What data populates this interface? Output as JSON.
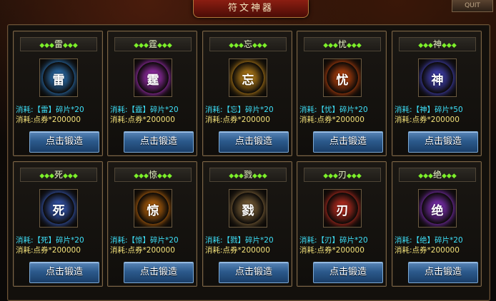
{
  "window": {
    "title": "符文神器",
    "quit_label": "QUIT"
  },
  "cards": [
    {
      "name": "雷",
      "cost_item": "消耗:【雷】碎片*20",
      "cost_coupon": "消耗:点券*200000",
      "button": "点击锻造",
      "color": "#3aa0ff"
    },
    {
      "name": "霆",
      "cost_item": "消耗:【霆】碎片*20",
      "cost_coupon": "消耗:点券*200000",
      "button": "点击锻造",
      "color": "#e040ff"
    },
    {
      "name": "忘",
      "cost_item": "消耗:【忘】碎片*20",
      "cost_coupon": "消耗:点券*200000",
      "button": "点击锻造",
      "color": "#ffb020"
    },
    {
      "name": "忧",
      "cost_item": "消耗:【忧】碎片*20",
      "cost_coupon": "消耗:点券*200000",
      "button": "点击锻造",
      "color": "#ff5a10"
    },
    {
      "name": "神",
      "cost_item": "消耗:【神】碎片*50",
      "cost_coupon": "消耗:点券*200000",
      "button": "点击锻造",
      "color": "#5a5aff"
    },
    {
      "name": "死",
      "cost_item": "消耗:【死】碎片*20",
      "cost_coupon": "消耗:点券*200000",
      "button": "点击锻造",
      "color": "#4a7cff"
    },
    {
      "name": "惊",
      "cost_item": "消耗:【惊】碎片*20",
      "cost_coupon": "消耗:点券*200000",
      "button": "点击锻造",
      "color": "#ff8a10"
    },
    {
      "name": "戮",
      "cost_item": "消耗:【戮】碎片*20",
      "cost_coupon": "消耗:点券*200000",
      "button": "点击锻造",
      "color": "#b08a50"
    },
    {
      "name": "刃",
      "cost_item": "消耗:【刃】碎片*20",
      "cost_coupon": "消耗:点券*200000",
      "button": "点击锻造",
      "color": "#ff3a2a"
    },
    {
      "name": "绝",
      "cost_item": "消耗:【绝】碎片*20",
      "cost_coupon": "消耗:点券*200000",
      "button": "点击锻造",
      "color": "#b040ff"
    }
  ]
}
